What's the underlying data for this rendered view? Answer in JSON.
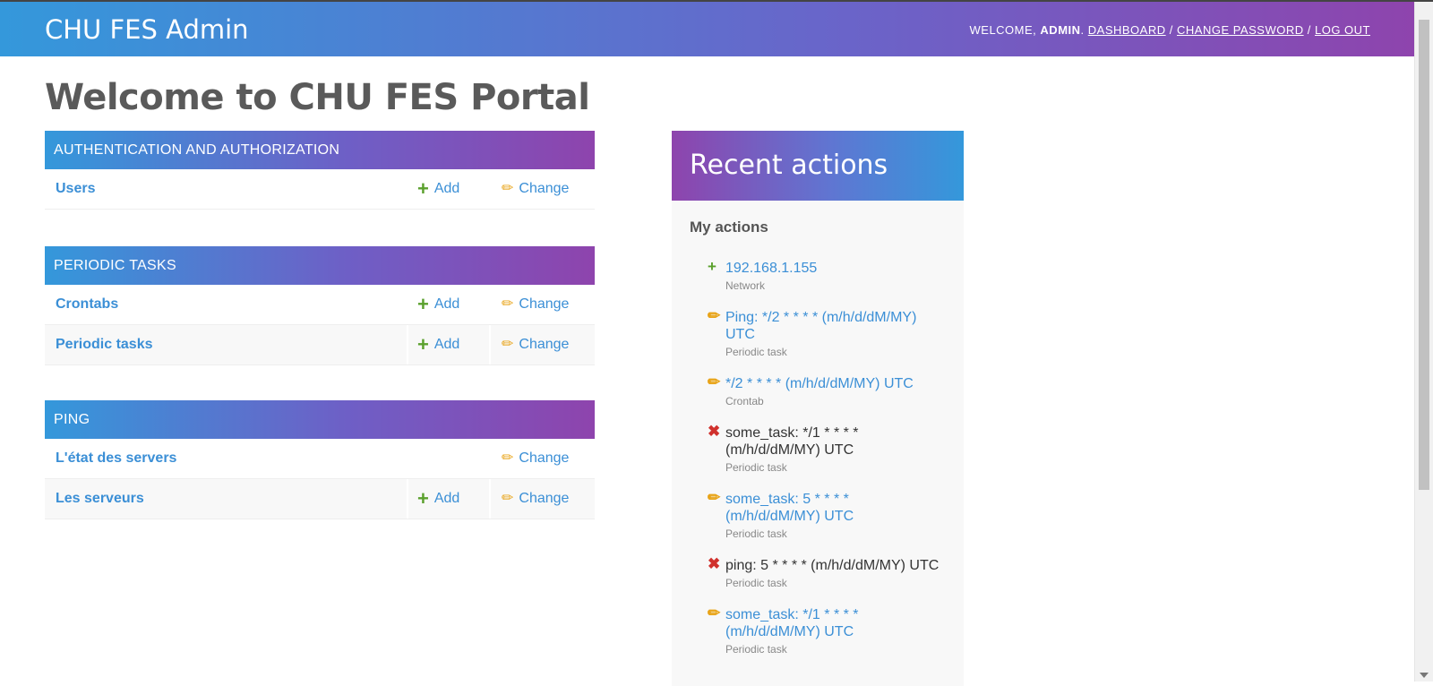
{
  "header": {
    "branding": "CHU FES Admin",
    "welcome": "Welcome,",
    "username": "admin",
    "dashboard": "Dashboard",
    "change_password": "Change password",
    "logout": "Log out",
    "sep": "/"
  },
  "page_title": "Welcome to CHU FES Portal",
  "modules": [
    {
      "caption": "Authentication and Authorization",
      "rows": [
        {
          "name": "Users",
          "add": "Add",
          "change": "Change"
        }
      ]
    },
    {
      "caption": "Periodic tasks",
      "rows": [
        {
          "name": "Crontabs",
          "add": "Add",
          "change": "Change"
        },
        {
          "name": "Periodic tasks",
          "add": "Add",
          "change": "Change"
        }
      ]
    },
    {
      "caption": "Ping",
      "rows": [
        {
          "name": "L'état des servers",
          "change": "Change"
        },
        {
          "name": "Les serveurs",
          "add": "Add",
          "change": "Change"
        }
      ]
    }
  ],
  "recent": {
    "title": "Recent actions",
    "subtitle": "My actions",
    "actions": [
      {
        "kind": "add",
        "title": "192.168.1.155",
        "type": "Network"
      },
      {
        "kind": "change",
        "title": "Ping: */2 * * * * (m/h/d/dM/MY) UTC",
        "type": "Periodic task"
      },
      {
        "kind": "change",
        "title": "*/2 * * * * (m/h/d/dM/MY) UTC",
        "type": "Crontab"
      },
      {
        "kind": "delete",
        "title": "some_task: */1 * * * * (m/h/d/dM/MY) UTC",
        "type": "Periodic task"
      },
      {
        "kind": "change",
        "title": "some_task: 5 * * * * (m/h/d/dM/MY) UTC",
        "type": "Periodic task"
      },
      {
        "kind": "delete",
        "title": "ping: 5 * * * * (m/h/d/dM/MY) UTC",
        "type": "Periodic task"
      },
      {
        "kind": "change",
        "title": "some_task: */1 * * * * (m/h/d/dM/MY) UTC",
        "type": "Periodic task"
      }
    ]
  },
  "icons": {
    "add": "plus-icon",
    "change": "pencil-icon",
    "delete": "cross-icon"
  },
  "colors": {
    "accent_blue": "#3498db",
    "accent_purple": "#8e44ad",
    "link": "#3b8fd6",
    "add_green": "#5aa02c",
    "change_orange": "#e8a419",
    "delete_red": "#d0312d"
  }
}
